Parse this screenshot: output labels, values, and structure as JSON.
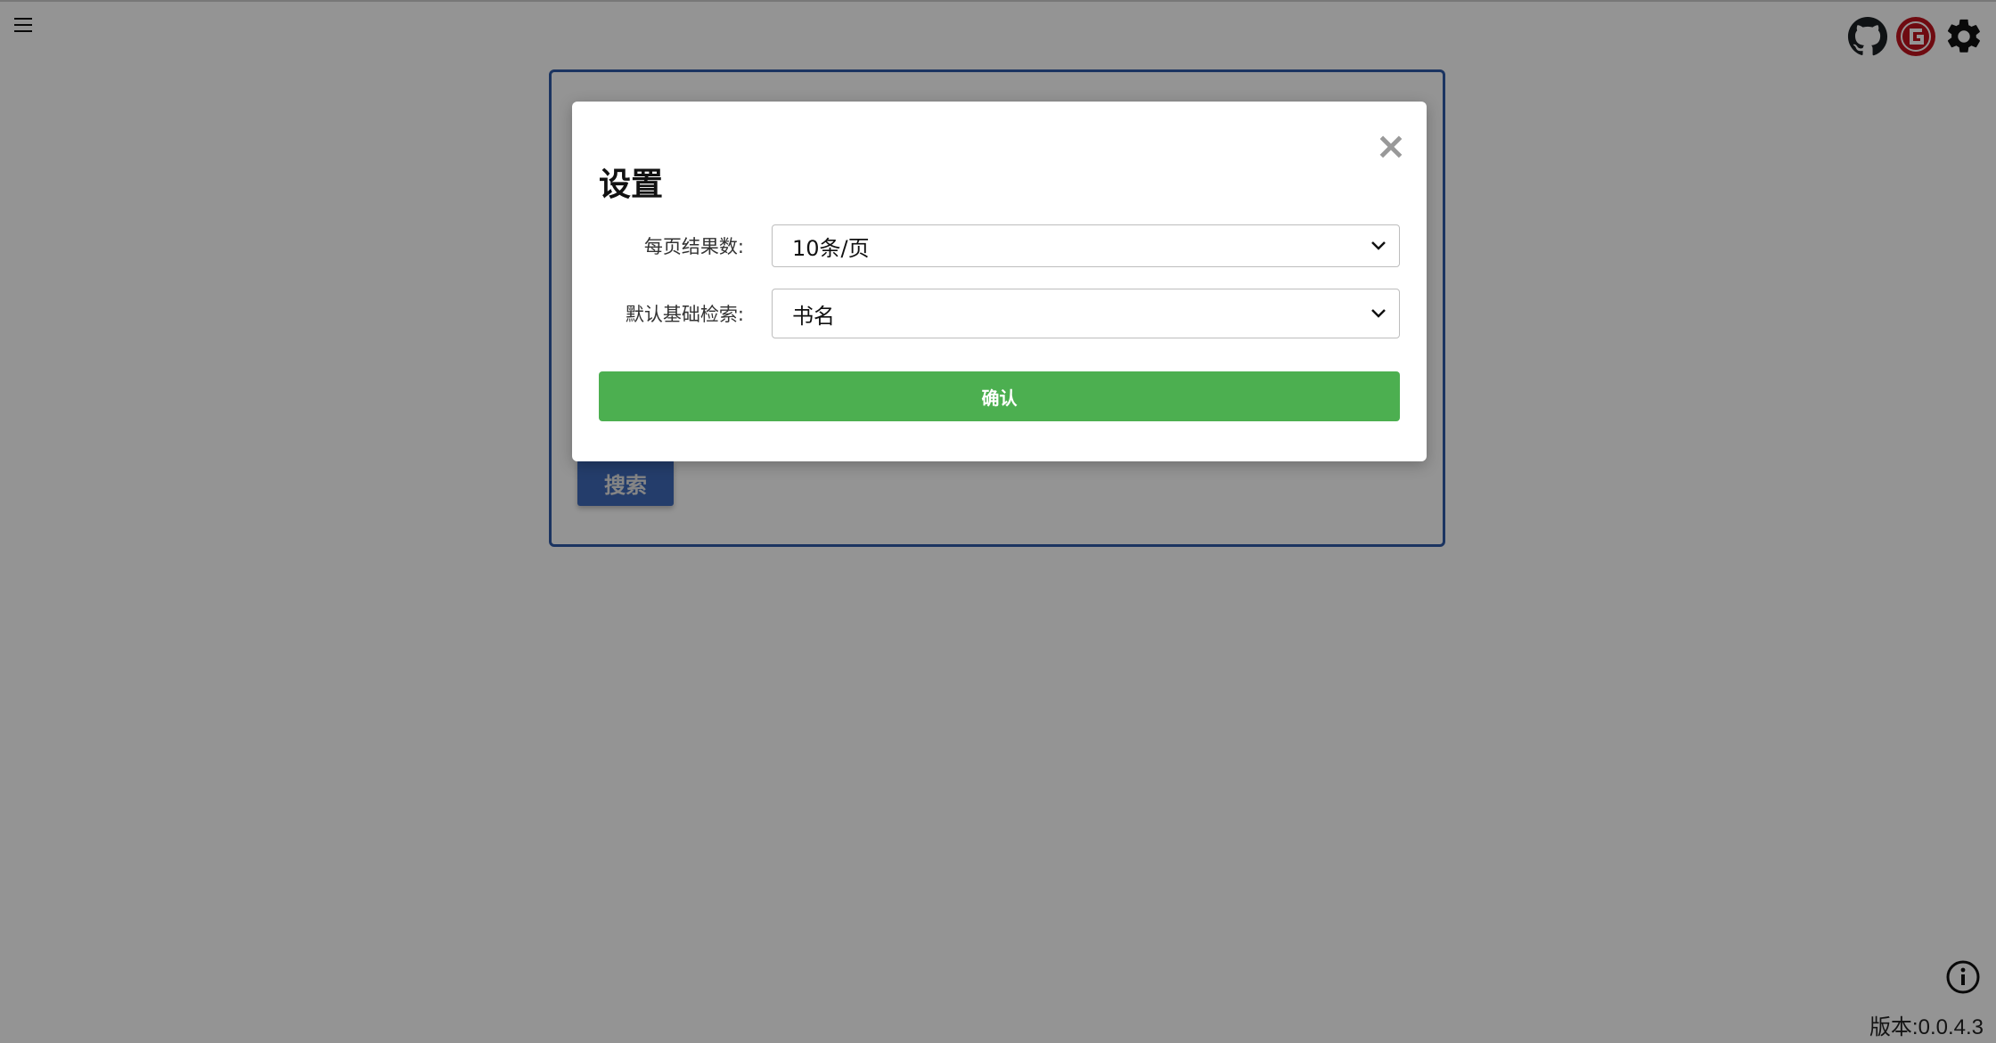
{
  "header": {
    "menu_icon": "hamburger-menu-icon",
    "icons": [
      "github-icon",
      "g-logo-icon",
      "gear-icon"
    ],
    "brand_red": "#c0141e"
  },
  "search": {
    "button_label": "搜索"
  },
  "footer": {
    "version_text": "版本:0.0.4.3",
    "info_icon": "info-icon"
  },
  "modal": {
    "title": "设置",
    "close_symbol": "×",
    "fields": [
      {
        "label": "每页结果数:",
        "selected": "10条/页"
      },
      {
        "label": "默认基础检索:",
        "selected": "书名"
      }
    ],
    "confirm_label": "确认"
  },
  "colors": {
    "accent_green": "#4caf50",
    "panel_border_blue": "#2f5aa8",
    "search_button_blue": "#3f6ab8"
  }
}
